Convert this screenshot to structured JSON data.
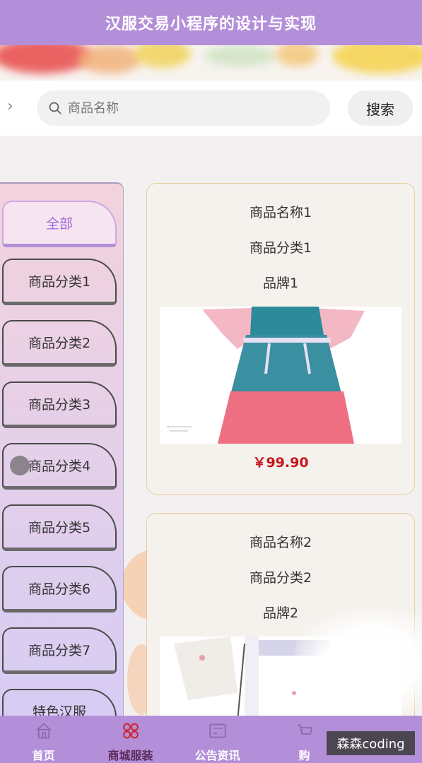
{
  "header": {
    "title": "汉服交易小程序的设计与实现"
  },
  "search": {
    "placeholder": "商品名称",
    "button_label": "搜索"
  },
  "sidebar": {
    "items": [
      {
        "label": "全部",
        "active": true
      },
      {
        "label": "商品分类1",
        "active": false
      },
      {
        "label": "商品分类2",
        "active": false
      },
      {
        "label": "商品分类3",
        "active": false
      },
      {
        "label": "商品分类4",
        "active": false
      },
      {
        "label": "商品分类5",
        "active": false
      },
      {
        "label": "商品分类6",
        "active": false
      },
      {
        "label": "商品分类7",
        "active": false
      },
      {
        "label": "特色汉服",
        "active": false
      }
    ]
  },
  "products": [
    {
      "name": "商品名称1",
      "category": "商品分类1",
      "brand": "品牌1",
      "price": "￥99.90"
    },
    {
      "name": "商品名称2",
      "category": "商品分类2",
      "brand": "品牌2",
      "price": ""
    }
  ],
  "tabbar": {
    "tabs": [
      {
        "label": "首页",
        "icon": "home-icon",
        "active": false
      },
      {
        "label": "商城服装",
        "icon": "shop-clothing-icon",
        "active": true
      },
      {
        "label": "公告资讯",
        "icon": "news-icon",
        "active": false
      },
      {
        "label": "购",
        "icon": "cart-icon",
        "active": false
      }
    ]
  },
  "watermark": {
    "text": "森森coding"
  },
  "colors": {
    "accent": "#b48fd9",
    "price": "#c6161b",
    "active_category_text": "#9d67d6"
  }
}
